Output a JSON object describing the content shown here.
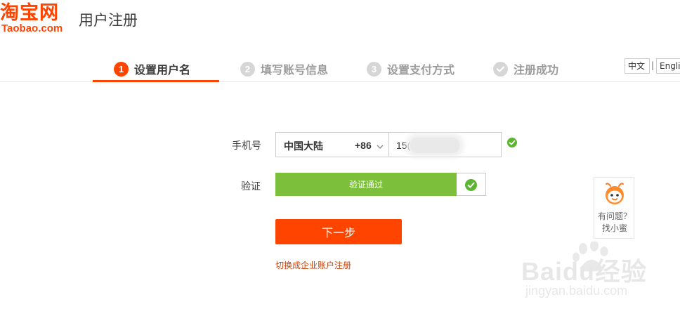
{
  "header": {
    "logo_cn": "淘宝网",
    "logo_en": "Taobao.com",
    "title": "用户注册"
  },
  "steps": [
    {
      "num": "1",
      "label": "设置用户名",
      "active": true
    },
    {
      "num": "2",
      "label": "填写账号信息",
      "active": false
    },
    {
      "num": "3",
      "label": "设置支付方式",
      "active": false
    },
    {
      "num": "",
      "label": "注册成功",
      "active": false
    }
  ],
  "language": {
    "zh": "中文",
    "separator": "|",
    "en": "English"
  },
  "form": {
    "phone_label": "手机号",
    "country_name": "中国大陆",
    "country_code": "+86",
    "phone_value": "15(",
    "verify_label": "验证",
    "verify_status": "验证通过",
    "next_button": "下一步",
    "enterprise_link": "切换成企业账户注册"
  },
  "help": {
    "line1": "有问题？",
    "line2": "找小蜜"
  },
  "watermark": {
    "main": "Baidu经验",
    "sub": "jingyan.baidu.com"
  },
  "colors": {
    "brand": "#ff4400",
    "success": "#7bbf3a",
    "check": "#5bb531",
    "link": "#c6420e"
  }
}
